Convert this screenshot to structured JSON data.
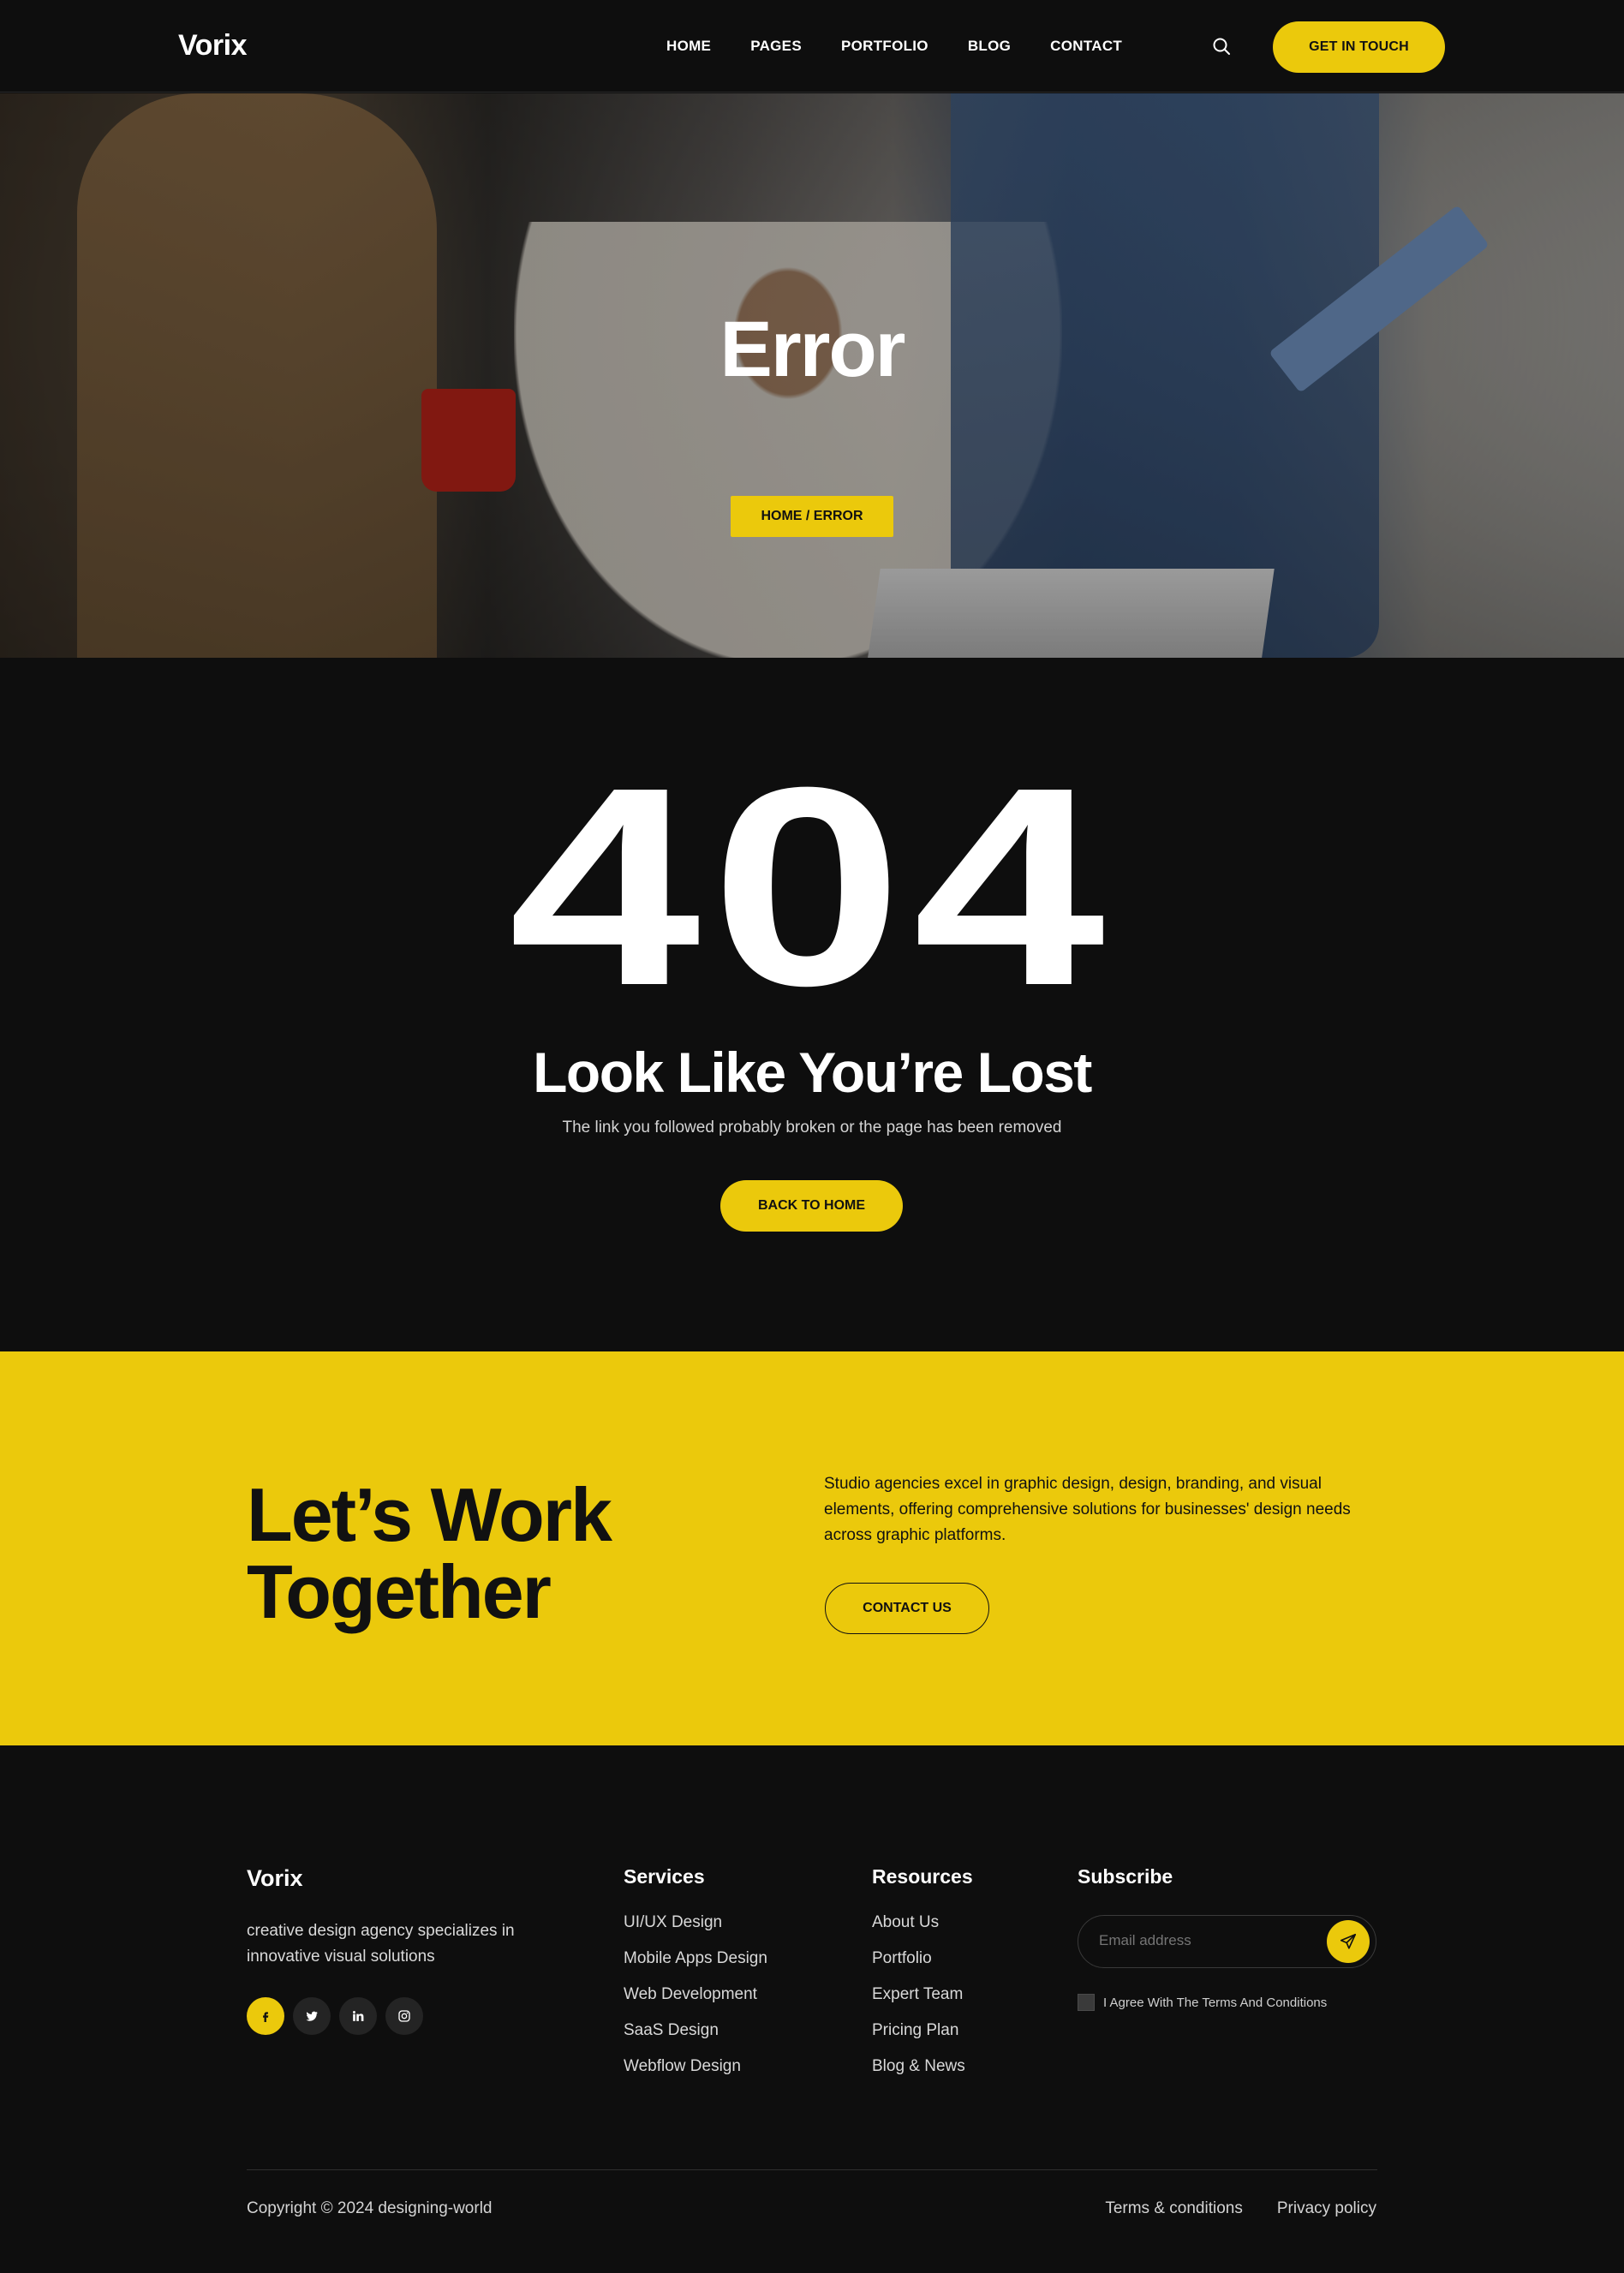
{
  "brand": {
    "name": "Vorix",
    "accent": "#ebc90c",
    "background": "#0e0e0e"
  },
  "nav": {
    "items": [
      "HOME",
      "PAGES",
      "PORTFOLIO",
      "BLOG",
      "CONTACT"
    ],
    "search_icon": "search-icon",
    "cta": "GET IN TOUCH"
  },
  "hero": {
    "title": "Error",
    "breadcrumb": "HOME / ERROR"
  },
  "error": {
    "code": "404",
    "heading": "Look Like You’re Lost",
    "subtext": "The link you followed probably broken or the page has been removed",
    "button": "BACK TO HOME"
  },
  "cta_band": {
    "title_line1": "Let’s Work",
    "title_line2": "Together",
    "text": "Studio agencies excel in graphic design, design, branding, and visual elements, offering comprehensive solutions for businesses' design needs across graphic platforms.",
    "button": "CONTACT US"
  },
  "footer": {
    "logo": "Vorix",
    "about": "creative design agency specializes in innovative visual solutions",
    "socials": [
      "facebook-icon",
      "twitter-icon",
      "linkedin-icon",
      "instagram-icon"
    ],
    "services": {
      "heading": "Services",
      "items": [
        "UI/UX Design",
        "Mobile Apps Design",
        "Web Development",
        "SaaS Design",
        "Webflow Design"
      ]
    },
    "resources": {
      "heading": "Resources",
      "items": [
        "About Us",
        "Portfolio",
        "Expert Team",
        "Pricing Plan",
        "Blog & News"
      ]
    },
    "subscribe": {
      "heading": "Subscribe",
      "placeholder": "Email address",
      "agree": "I Agree With The Terms And Conditions"
    },
    "copyright": "Copyright © 2024 designing-world",
    "legal": [
      "Terms & conditions",
      "Privacy policy"
    ]
  }
}
